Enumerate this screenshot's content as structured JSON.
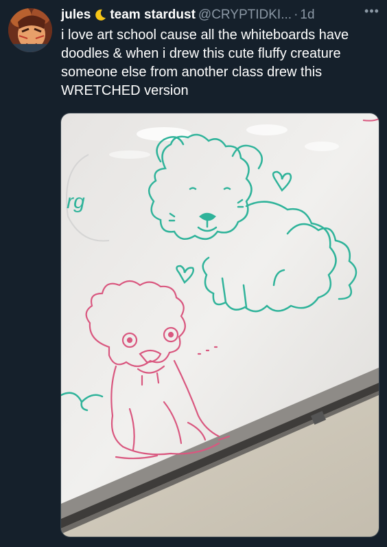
{
  "tweet": {
    "display_name": "jules",
    "team_label": "team stardust",
    "handle": "@CRYPTIDKI...",
    "separator": "·",
    "time": "1d",
    "more_label": "•••",
    "text": "i love art school cause all the whiteboards have doodles & when i drew this cute fluffy creature someone else from another class drew this WRETCHED version"
  },
  "media": {
    "board_text": "rg",
    "icon": "photo-whiteboard-doodles"
  },
  "colors": {
    "background": "#15202b",
    "secondary_text": "#8b98a5",
    "teal_marker": "#2fb39a",
    "pink_marker": "#d9577f",
    "moon": "#f5c518"
  }
}
